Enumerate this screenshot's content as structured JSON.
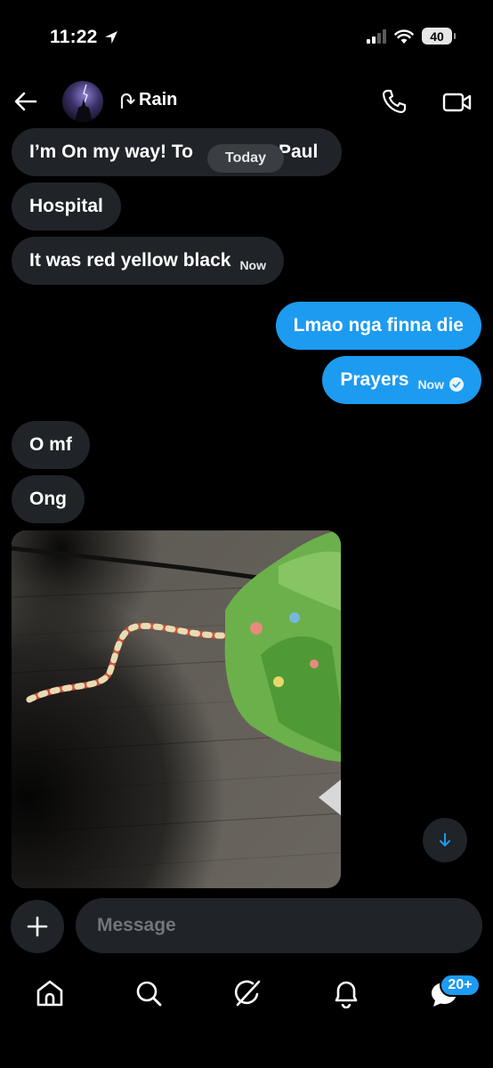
{
  "status_bar": {
    "time": "11:22",
    "battery": "40"
  },
  "header": {
    "name": "Rain",
    "name_prefix_icon": "u-turn-icon"
  },
  "date_divider": "Today",
  "messages": [
    {
      "side": "in",
      "text": "I’m On my way! To ",
      "text_end": "Paul"
    },
    {
      "side": "in",
      "text": "Hospital"
    },
    {
      "side": "in",
      "text": "It was red yellow black",
      "time": "Now"
    },
    {
      "side": "out",
      "text": "Lmao nga finna die"
    },
    {
      "side": "out",
      "text": "Prayers",
      "time": "Now",
      "status": "seen"
    },
    {
      "side": "in",
      "text": "O mf"
    },
    {
      "side": "in",
      "text": "Ong"
    },
    {
      "side": "in",
      "type": "image",
      "content": "snake on wooden floor"
    }
  ],
  "composer": {
    "placeholder": "Message"
  },
  "bottom_nav": {
    "items": [
      "home-icon",
      "search-icon",
      "grok-icon",
      "notifications-icon",
      "messages-icon"
    ],
    "messages_badge": "20+"
  },
  "colors": {
    "accent": "#1d9bf0",
    "incoming_bubble": "#202327",
    "background": "#000000"
  }
}
